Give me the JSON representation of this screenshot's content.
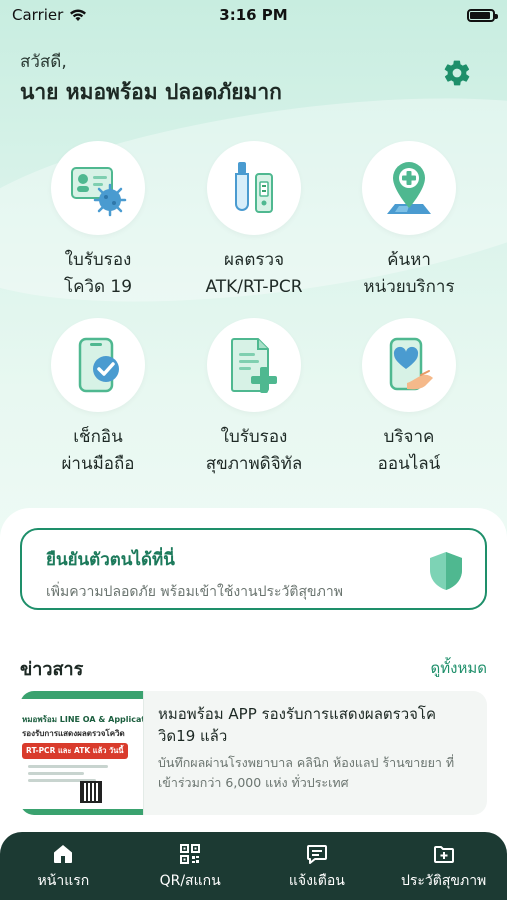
{
  "status_bar": {
    "carrier": "Carrier",
    "time": "3:16 PM"
  },
  "header": {
    "greeting": "สวัสดี,",
    "username": "นาย หมอพร้อม ปลอดภัยมาก"
  },
  "services": [
    {
      "line1": "ใบรับรอง",
      "line2": "โควิด 19",
      "icon": "certificate-virus-icon"
    },
    {
      "line1": "ผลตรวจ",
      "line2": "ATK/RT-PCR",
      "icon": "test-kit-icon"
    },
    {
      "line1": "ค้นหา",
      "line2": "หน่วยบริการ",
      "icon": "location-pin-icon"
    },
    {
      "line1": "เช็กอิน",
      "line2": "ผ่านมือถือ",
      "icon": "phone-check-icon"
    },
    {
      "line1": "ใบรับรอง",
      "line2": "สุขภาพดิจิทัล",
      "icon": "digital-health-doc-icon"
    },
    {
      "line1": "บริจาค",
      "line2": "ออนไลน์",
      "icon": "donate-heart-icon"
    }
  ],
  "verify": {
    "title": "ยืนยันตัวตนได้ที่นี่",
    "subtitle": "เพิ่มความปลอดภัย พร้อมเข้าใช้งานประวัติสุขภาพ"
  },
  "news": {
    "section_title": "ข่าวสาร",
    "see_all": "ดูทั้งหมด",
    "items": [
      {
        "thumb_line1": "หมอพร้อม LINE OA & Application",
        "thumb_line2": "รองรับการแสดงผลตรวจโควิด",
        "thumb_pill": "RT-PCR และ ATK แล้ว วันนี้",
        "headline": "หมอพร้อม APP รองรับการแสดงผลตรวจโควิด19 แล้ว",
        "description": "บันทึกผลผ่านโรงพยาบาล คลินิก ห้องแลป ร้านขายยา ที่เข้าร่วมกว่า 6,000 แห่ง ทั่วประเทศ"
      }
    ]
  },
  "tabs": [
    {
      "label": "หน้าแรก",
      "icon": "home-icon"
    },
    {
      "label": "QR/สแกน",
      "icon": "qr-scan-icon"
    },
    {
      "label": "แจ้งเตือน",
      "icon": "message-icon"
    },
    {
      "label": "ประวัติสุขภาพ",
      "icon": "health-folder-icon"
    }
  ],
  "colors": {
    "brand_green": "#1e8f6a",
    "tabbar_bg": "#1c3a33",
    "hero_bg": "#c8ede0"
  }
}
